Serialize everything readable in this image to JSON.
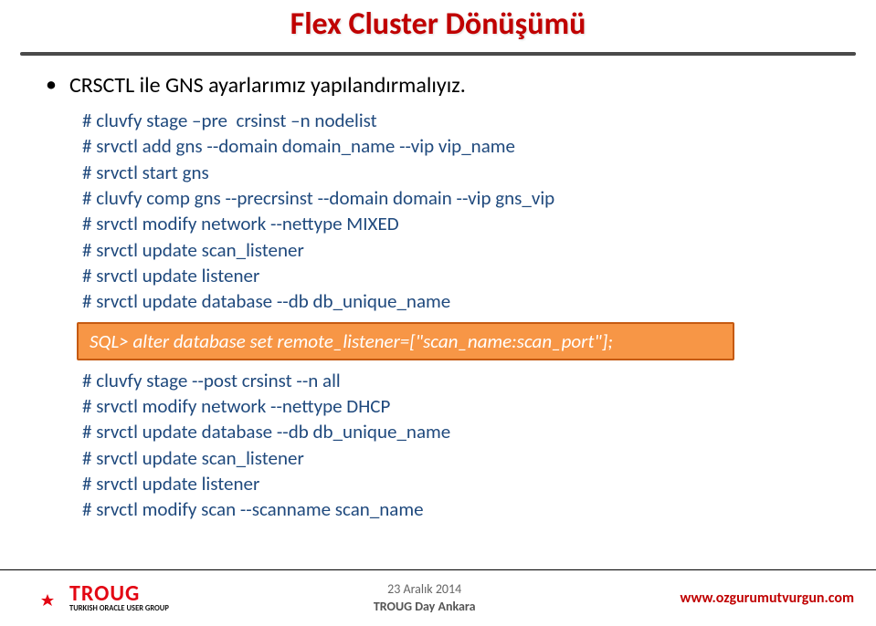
{
  "title": "Flex Cluster Dönüşümü",
  "bullet": "CRSCTL  ile  GNS ayarlarımız yapılandırmalıyız.",
  "code_top": [
    "# cluvfy stage –pre  crsinst –n nodelist",
    "# srvctl add gns --domain domain_name --vip vip_name",
    "# srvctl start gns",
    "# cluvfy comp gns --precrsinst --domain domain --vip gns_vip",
    "# srvctl modify network --nettype MIXED",
    "# srvctl update scan_listener",
    "# srvctl update listener",
    "# srvctl update database --db db_unique_name"
  ],
  "sql_callout": "SQL> alter database set remote_listener=[\"scan_name:scan_port\"];",
  "code_bottom": [
    "# cluvfy stage --post crsinst --n all",
    "# srvctl modify network --nettype DHCP",
    "# srvctl update database --db db_unique_name",
    "# srvctl update scan_listener",
    "# srvctl update listener",
    "# srvctl modify scan --scanname scan_name"
  ],
  "footer": {
    "logo_word": "TROUG",
    "logo_sub": "TURKISH ORACLE USER GROUP",
    "center_line1": "23 Aralık  2014",
    "center_line2": "TROUG Day  Ankara",
    "url": "www.ozgurumutvurgun.com"
  }
}
